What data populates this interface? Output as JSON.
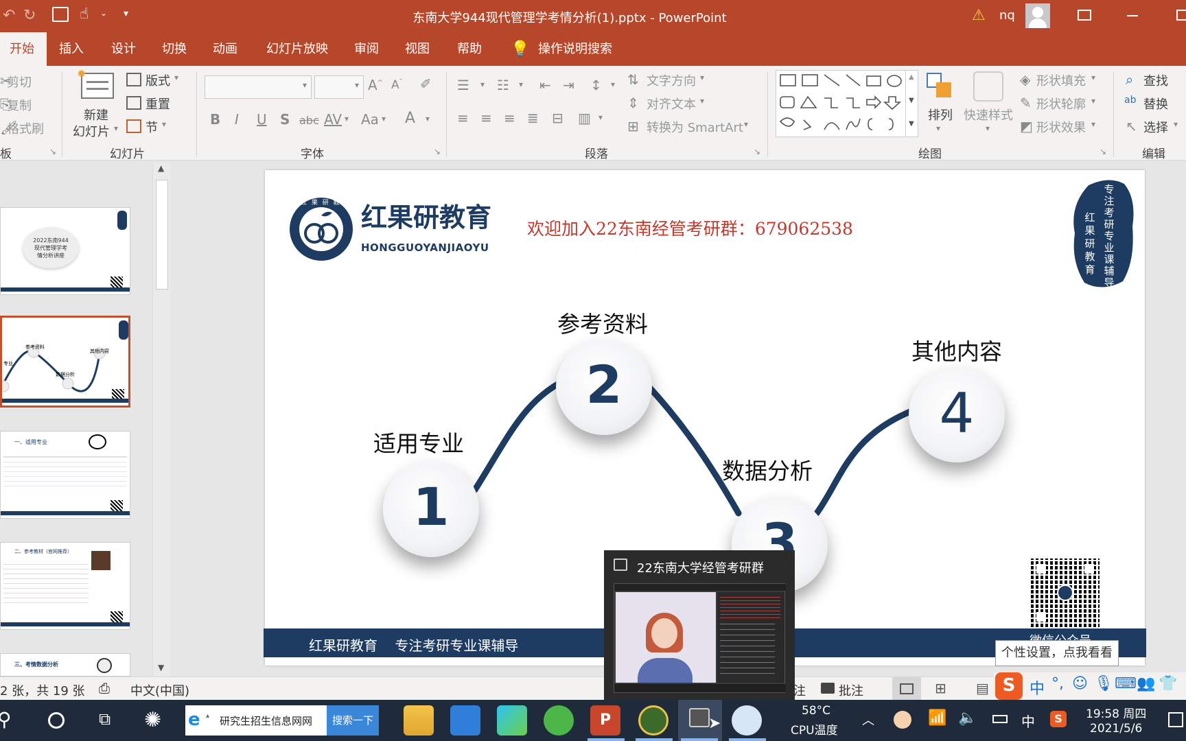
{
  "window": {
    "title": "东南大学944现代管理学考情分析(1).pptx  -  PowerPoint",
    "user": "nq"
  },
  "tabs": [
    {
      "label": "开始"
    },
    {
      "label": "插入"
    },
    {
      "label": "设计"
    },
    {
      "label": "切换"
    },
    {
      "label": "动画"
    },
    {
      "label": "幻灯片放映"
    },
    {
      "label": "审阅"
    },
    {
      "label": "视图"
    },
    {
      "label": "帮助"
    }
  ],
  "tell_me": "操作说明搜索",
  "ribbon": {
    "clipboard": {
      "cut": "剪切",
      "copy": "复制",
      "format_painter": "格式刷",
      "label": "板"
    },
    "slides": {
      "new_slide_line1": "新建",
      "new_slide_line2": "幻灯片",
      "layout": "版式",
      "reset": "重置",
      "section": "节",
      "label": "幻灯片"
    },
    "font": {
      "label": "字体",
      "bold": "B",
      "italic": "I",
      "underline": "U",
      "shadow": "S",
      "strike": "abc",
      "spacing": "AV",
      "case": "Aa",
      "color": "A"
    },
    "paragraph": {
      "label": "段落",
      "text_direction": "文字方向",
      "align_text": "对齐文本",
      "smartart": "转换为 SmartArt"
    },
    "drawing": {
      "label": "绘图",
      "arrange": "排列",
      "quick_styles": "快速样式",
      "shape_fill": "形状填充",
      "shape_outline": "形状轮廓",
      "shape_effects": "形状效果"
    },
    "editing": {
      "label": "编辑",
      "find": "查找",
      "replace": "替换",
      "select": "选择"
    }
  },
  "slide": {
    "logo_cn": "红果研教育",
    "logo_en": "HONGGUOYANJIAOYU",
    "logo_ring": "红 果 研 教 育",
    "banner": "欢迎加入22东南经管考研群：679062538",
    "seal_text_col1": "专注考研专业课辅导",
    "seal_text_col2": "红果研教育",
    "steps": [
      {
        "number": "1",
        "label": "适用专业"
      },
      {
        "number": "2",
        "label": "参考资料"
      },
      {
        "number": "3",
        "label": "数据分析"
      },
      {
        "number": "4",
        "label": "其他内容"
      }
    ],
    "footer": "红果研教育    专注考研专业课辅导",
    "qr_caption": "微信公众号"
  },
  "thumbnails": {
    "t1_title": "2022东南944\n现代管理学考\n情分析讲座",
    "t2_labels": [
      "参考资料",
      "其他内容",
      "数据分析",
      "专业"
    ],
    "t3_title": "一、适用专业",
    "t4_title": "二、参考教材（官网推荐）",
    "t5_title": "三、考情数据分析"
  },
  "status": {
    "slide_count": "2 张，共 19 张",
    "language": "中文(中国)",
    "notes_partial": "注",
    "comments": "批注"
  },
  "popup": {
    "title": "22东南大学经管考研群"
  },
  "tooltip": "个性设置，点我看看",
  "taskbar": {
    "ie_text": "研究生招生信息网网",
    "search_button": "搜索一下",
    "temp": "58°C",
    "temp_label": "CPU温度",
    "ime": "中",
    "time": "19:58 周四",
    "date": "2021/5/6"
  },
  "colors": {
    "accent": "#b7472a",
    "navy": "#1e3c62",
    "banner_red": "#c0392b"
  }
}
